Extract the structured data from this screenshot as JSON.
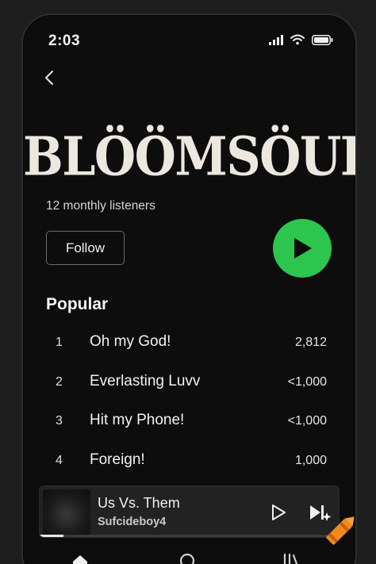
{
  "status_bar": {
    "time": "2:03",
    "icons": [
      "signal-icon",
      "wifi-icon",
      "battery-icon"
    ]
  },
  "header": {
    "back_icon": "chevron-left-icon"
  },
  "artist": {
    "name": "BLÖÖMSÖUL",
    "monthly_listeners": "12 monthly listeners",
    "follow_label": "Follow",
    "play_icon": "play-icon"
  },
  "popular": {
    "title": "Popular",
    "tracks": [
      {
        "rank": "1",
        "title": "Oh my God!",
        "plays": "2,812"
      },
      {
        "rank": "2",
        "title": "Everlasting Luvv",
        "plays": "<1,000"
      },
      {
        "rank": "3",
        "title": "Hit my Phone!",
        "plays": "<1,000"
      },
      {
        "rank": "4",
        "title": "Foreign!",
        "plays": "1,000"
      }
    ]
  },
  "now_playing": {
    "title": "Us Vs. Them",
    "artist": "Sufcideboy4",
    "progress": 0.08
  },
  "bottom_nav": {
    "items": [
      "home-icon",
      "search-icon",
      "library-icon"
    ]
  },
  "colors": {
    "accent_green": "#2cc64f",
    "background": "#0d0d0d",
    "player_bg": "#222222"
  }
}
